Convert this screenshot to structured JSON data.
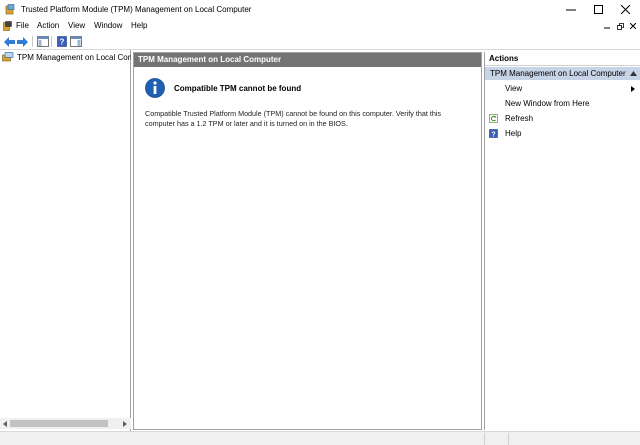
{
  "window": {
    "title": "Trusted Platform Module (TPM) Management on Local Computer",
    "controls": [
      "minimize",
      "maximize",
      "close"
    ]
  },
  "menubar": {
    "items": [
      "File",
      "Action",
      "View",
      "Window",
      "Help"
    ]
  },
  "toolbar": {
    "buttons": [
      "back-arrow-icon",
      "forward-arrow-icon",
      "show-hide-console-tree-icon",
      "help-icon",
      "show-hide-action-pane-icon"
    ]
  },
  "tree": {
    "items": [
      {
        "label": "TPM Management on Local Comp",
        "icon": "tpm-computer-icon",
        "selected": true
      }
    ]
  },
  "center": {
    "header": "TPM Management on Local Computer",
    "message_title": "Compatible TPM cannot be found",
    "message_body": "Compatible Trusted Platform Module (TPM) cannot be found on this computer. Verify that this computer has a 1.2 TPM or later and it is turned on in the BIOS.",
    "icon": "info-icon"
  },
  "actions": {
    "header": "Actions",
    "section": "TPM Management on Local Computer",
    "items": [
      {
        "label": "View",
        "icon": "",
        "submenu": true
      },
      {
        "label": "New Window from Here",
        "icon": "",
        "submenu": false
      },
      {
        "label": "Refresh",
        "icon": "refresh-icon",
        "submenu": false
      },
      {
        "label": "Help",
        "icon": "help-icon",
        "submenu": false
      }
    ]
  },
  "colors": {
    "center_header_bg": "#747474",
    "action_section_bg": "#c7d3e6",
    "info_blue": "#1f5fb4",
    "status_bar": "#f0f0f0"
  }
}
